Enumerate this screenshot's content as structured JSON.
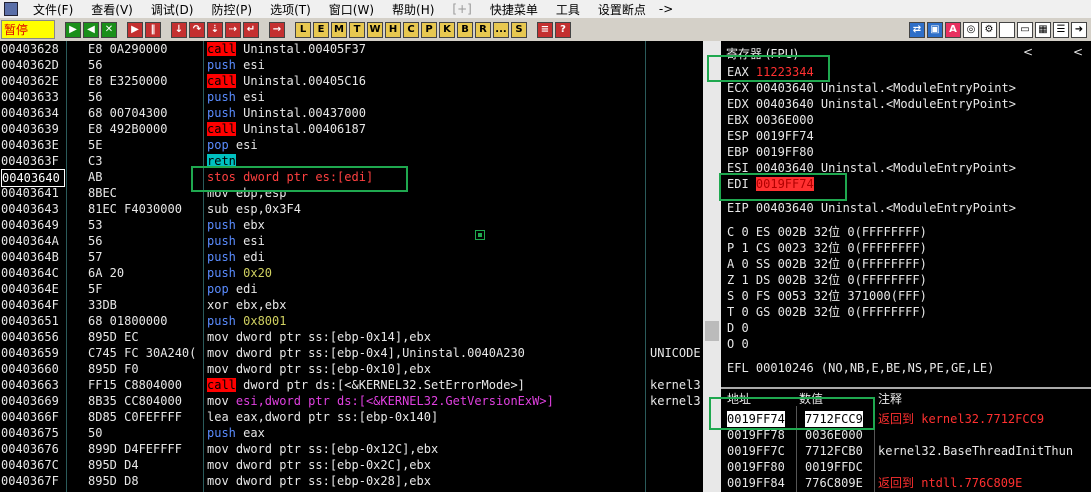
{
  "menu": {
    "items": [
      "文件(F)",
      "查看(V)",
      "调试(D)",
      "防控(P)",
      "选项(T)",
      "窗口(W)",
      "帮助(H)",
      "[+]",
      "快捷菜单",
      "工具",
      "设置断点",
      "->"
    ]
  },
  "toolbar": {
    "status": "暂停",
    "letters": [
      "L",
      "E",
      "M",
      "T",
      "W",
      "H",
      "C",
      "P",
      "K",
      "B",
      "R",
      "...",
      "S"
    ]
  },
  "disasm": [
    {
      "addr": "00403628",
      "hex": "E8 0A290000",
      "op": "call",
      "ops": " Uninstal.00405F37",
      "cmt": ""
    },
    {
      "addr": "0040362D",
      "hex": "56",
      "op": "push",
      "ops": " esi",
      "cmt": ""
    },
    {
      "addr": "0040362E",
      "hex": "E8 E3250000",
      "op": "call",
      "ops": " Uninstal.00405C16",
      "cmt": ""
    },
    {
      "addr": "00403633",
      "hex": "56",
      "op": "push",
      "ops": " esi",
      "cmt": ""
    },
    {
      "addr": "00403634",
      "hex": "68 00704300",
      "op": "push",
      "ops": " Uninstal.00437000",
      "cmt": ""
    },
    {
      "addr": "00403639",
      "hex": "E8 492B0000",
      "op": "call",
      "ops": " Uninstal.00406187",
      "cmt": ""
    },
    {
      "addr": "0040363E",
      "hex": "5E",
      "op": "pop",
      "ops": " esi",
      "cmt": ""
    },
    {
      "addr": "0040363F",
      "hex": "C3",
      "op": "retn",
      "ops": "",
      "cmt": ""
    },
    {
      "addr": "00403640",
      "hex": "AB",
      "op": "stos",
      "ops": " dword ptr es:[edi]",
      "cmt": ""
    },
    {
      "addr": "00403641",
      "hex": "8BEC",
      "op": "mov",
      "ops": " ebp,esp",
      "cmt": ""
    },
    {
      "addr": "00403643",
      "hex": "81EC F4030000",
      "op": "sub",
      "ops": " esp,0x3F4",
      "cmt": ""
    },
    {
      "addr": "00403649",
      "hex": "53",
      "op": "push",
      "ops": " ebx",
      "cmt": ""
    },
    {
      "addr": "0040364A",
      "hex": "56",
      "op": "push",
      "ops": " esi",
      "cmt": ""
    },
    {
      "addr": "0040364B",
      "hex": "57",
      "op": "push",
      "ops": " edi",
      "cmt": ""
    },
    {
      "addr": "0040364C",
      "hex": "6A 20",
      "op": "push",
      "ops": " 0x20",
      "cmt": ""
    },
    {
      "addr": "0040364E",
      "hex": "5F",
      "op": "pop",
      "ops": " edi",
      "cmt": ""
    },
    {
      "addr": "0040364F",
      "hex": "33DB",
      "op": "xor",
      "ops": " ebx,ebx",
      "cmt": ""
    },
    {
      "addr": "00403651",
      "hex": "68 01800000",
      "op": "push",
      "ops": " 0x8001",
      "cmt": ""
    },
    {
      "addr": "00403656",
      "hex": "895D EC",
      "op": "mov",
      "ops": " dword ptr ss:[ebp-0x14],ebx",
      "cmt": ""
    },
    {
      "addr": "00403659",
      "hex": "C745 FC 30A240(",
      "op": "mov",
      "ops": " dword ptr ss:[ebp-0x4],Uninstal.0040A230",
      "cmt": "UNICODE"
    },
    {
      "addr": "00403660",
      "hex": "895D F0",
      "op": "mov",
      "ops": " dword ptr ss:[ebp-0x10],ebx",
      "cmt": ""
    },
    {
      "addr": "00403663",
      "hex": "FF15 C8804000",
      "op": "call",
      "ops": " dword ptr ds:[<&KERNEL32.SetErrorMode>]",
      "cmt": "kernel3"
    },
    {
      "addr": "00403669",
      "hex": "8B35 CC804000",
      "op": "mov",
      "ops": " esi,dword ptr ds:[<&KERNEL32.GetVersionExW>]",
      "cmt": "kernel3"
    },
    {
      "addr": "0040366F",
      "hex": "8D85 C0FEFFFF",
      "op": "lea",
      "ops": " eax,dword ptr ss:[ebp-0x140]",
      "cmt": ""
    },
    {
      "addr": "00403675",
      "hex": "50",
      "op": "push",
      "ops": " eax",
      "cmt": ""
    },
    {
      "addr": "00403676",
      "hex": "899D D4FEFFFF",
      "op": "mov",
      "ops": " dword ptr ss:[ebp-0x12C],ebx",
      "cmt": ""
    },
    {
      "addr": "0040367C",
      "hex": "895D D4",
      "op": "mov",
      "ops": " dword ptr ss:[ebp-0x2C],ebx",
      "cmt": ""
    },
    {
      "addr": "0040367F",
      "hex": "895D D8",
      "op": "mov",
      "ops": " dword ptr ss:[ebp-0x28],ebx",
      "cmt": ""
    }
  ],
  "registers": {
    "title": "寄存器 (FPU)",
    "arrows": [
      "<",
      "<"
    ],
    "lines": [
      "EAX 11223344",
      "ECX 00403640 Uninstal.<ModuleEntryPoint>",
      "EDX 00403640 Uninstal.<ModuleEntryPoint>",
      "EBX 0036E000",
      "ESP 0019FF74",
      "EBP 0019FF80",
      "ESI 00403640 Uninstal.<ModuleEntryPoint>",
      "EDI 0019FF74",
      "",
      "EIP 00403640 Uninstal.<ModuleEntryPoint>",
      "",
      "C 0  ES 002B 32位 0(FFFFFFFF)",
      "P 1  CS 0023 32位 0(FFFFFFFF)",
      "A 0  SS 002B 32位 0(FFFFFFFF)",
      "Z 1  DS 002B 32位 0(FFFFFFFF)",
      "S 0  FS 0053 32位 371000(FFF)",
      "T 0  GS 002B 32位 0(FFFFFFFF)",
      "D 0",
      "O 0",
      "",
      "EFL 00010246 (NO,NB,E,BE,NS,PE,GE,LE)"
    ]
  },
  "stack": {
    "headers": [
      "地址",
      "数值",
      "注释"
    ],
    "rows": [
      {
        "a": "0019FF74",
        "v": "7712FCC9",
        "c": "返回到 kernel32.7712FCC9",
        "red": true
      },
      {
        "a": "0019FF78",
        "v": "0036E000",
        "c": "",
        "red": false
      },
      {
        "a": "0019FF7C",
        "v": "7712FCB0",
        "c": "kernel32.BaseThreadInitThun",
        "red": false
      },
      {
        "a": "0019FF80",
        "v": "0019FFDC",
        "c": "",
        "red": false
      },
      {
        "a": "0019FF84",
        "v": "776C809E",
        "c": "返回到 ntdll.776C809E",
        "red": true
      }
    ]
  },
  "colors": {
    "highlight_box": "#1fa84f",
    "call_bg": "#ff0000",
    "push_fg": "#5a8cff",
    "retn_bg": "#00c0c0",
    "stos_fg": "#ff4040"
  }
}
